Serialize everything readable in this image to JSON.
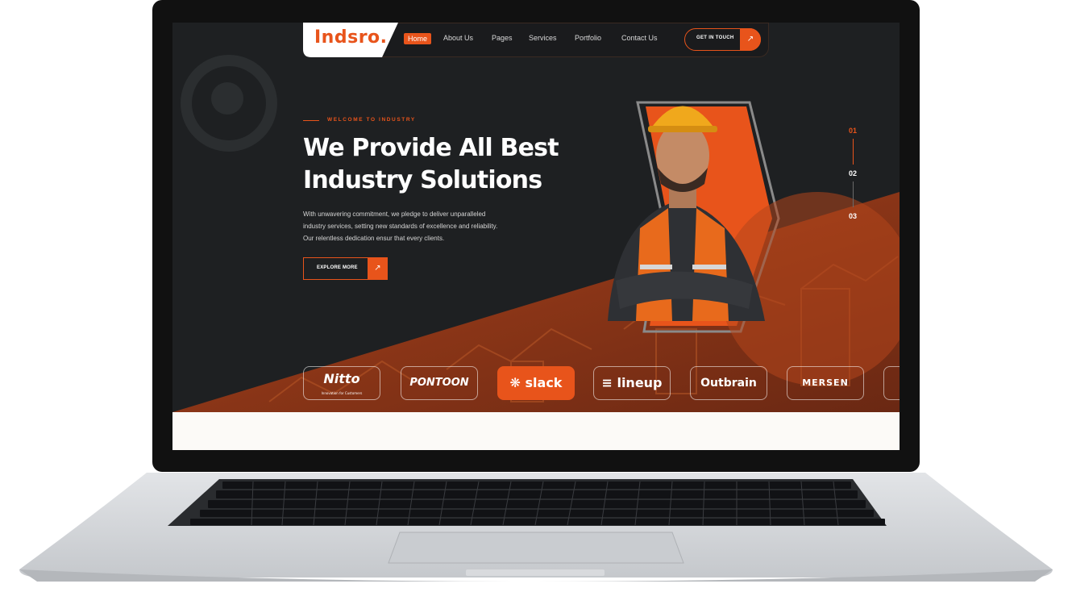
{
  "nav": {
    "logo": "Indsro.",
    "items": [
      "Home",
      "About Us",
      "Pages",
      "Services",
      "Portfolio",
      "Contact Us"
    ],
    "cta_label": "GET IN TOUCH",
    "cta_icon": "arrow-up-right-icon"
  },
  "hero": {
    "kicker": "WELCOME TO INDUSTRY",
    "title_line1": "We Provide All Best",
    "title_line2": "Industry Solutions",
    "paragraph_line1": "With unwavering commitment, we pledge to deliver unparalleled",
    "paragraph_line2": "industry services, setting new standards of excellence and reliability.",
    "paragraph_line3": "Our relentless dedication ensur that every clients.",
    "button_label": "EXPLORE MORE",
    "button_icon": "arrow-up-right-icon"
  },
  "pager": {
    "items": [
      "01",
      "02",
      "03"
    ],
    "active": "01"
  },
  "brands": {
    "items": [
      "Nitto",
      "PONTOON",
      "slack",
      "lineup",
      "Outbrain",
      "MERSEN"
    ],
    "nitto_tagline": "Innovation for Customers",
    "active": "slack"
  },
  "colors": {
    "accent": "#e8541b",
    "dark": "#1e2022",
    "laptop_silver": "#d7d9dc"
  }
}
